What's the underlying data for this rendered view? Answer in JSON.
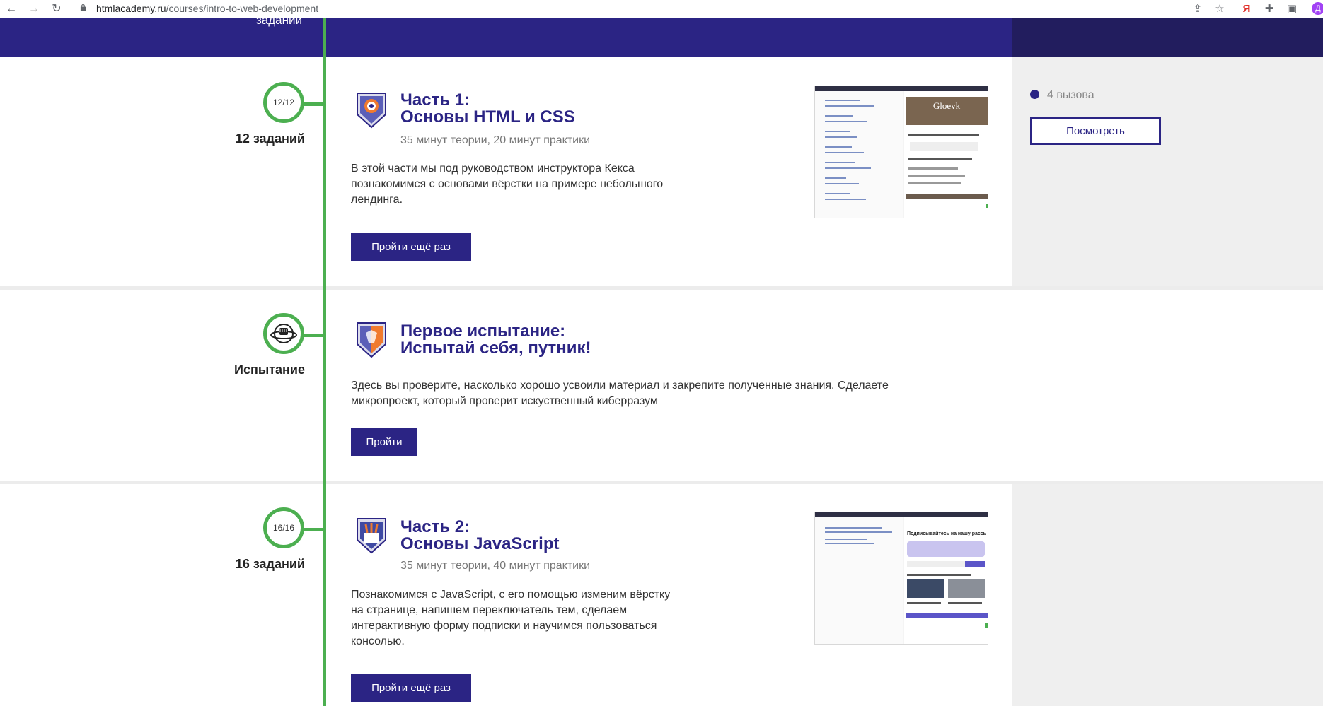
{
  "browser": {
    "url_domain": "htmlacademy.ru",
    "url_path": "/courses/intro-to-web-development",
    "back_glyph": "←",
    "forward_glyph": "→",
    "reload_glyph": "↻",
    "share_glyph": "⇪",
    "star_glyph": "☆",
    "ya_glyph": "Я",
    "ext_glyph": "✚",
    "panel_glyph": "▣",
    "avatar_letter": "Д"
  },
  "top_band": {
    "cut_label": "заданий"
  },
  "chapters": [
    {
      "progress": "12/12",
      "tasks_caption": "12 заданий",
      "title_line1": "Часть 1:",
      "title_line2": "Основы HTML и CSS",
      "meta": "35 минут теории, 20 минут практики",
      "desc_line1": "В этой части мы под руководством инструктора Кекса",
      "desc_line2": "познакомимся с основами вёрстки на примере небольшого",
      "desc_line3": "лендинга.",
      "button": "Пройти ещё раз",
      "side": {
        "calls": "4 вызова",
        "button": "Посмотреть"
      },
      "thumb_brand": "Gloevk"
    },
    {
      "caption": "Испытание",
      "title_line1": "Первое испытание:",
      "title_line2": "Испытай себя, путник!",
      "desc_line1": "Здесь вы проверите, насколько хорошо усвоили материал и закрепите полученные знания. Сделаете",
      "desc_line2": "микропроект, который проверит искуственный киберразум",
      "button": "Пройти"
    },
    {
      "progress": "16/16",
      "tasks_caption": "16 заданий",
      "title_line1": "Часть 2:",
      "title_line2": "Основы JavaScript",
      "meta": "35 минут теории, 40 минут практики",
      "desc_line1": "Познакомимся с JavaScript, с его помощью изменим вёрстку",
      "desc_line2": "на странице, напишем переключатель тем, сделаем",
      "desc_line3": "интерактивную форму подписки и научимся пользоваться",
      "desc_line4": "консолью.",
      "button": "Пройти ещё раз",
      "thumb_heading": "Подписывайтесь на нашу рассылку"
    }
  ],
  "colors": {
    "brand": "#2b2484",
    "timeline": "#4caf50",
    "side_gray": "#efefef"
  }
}
